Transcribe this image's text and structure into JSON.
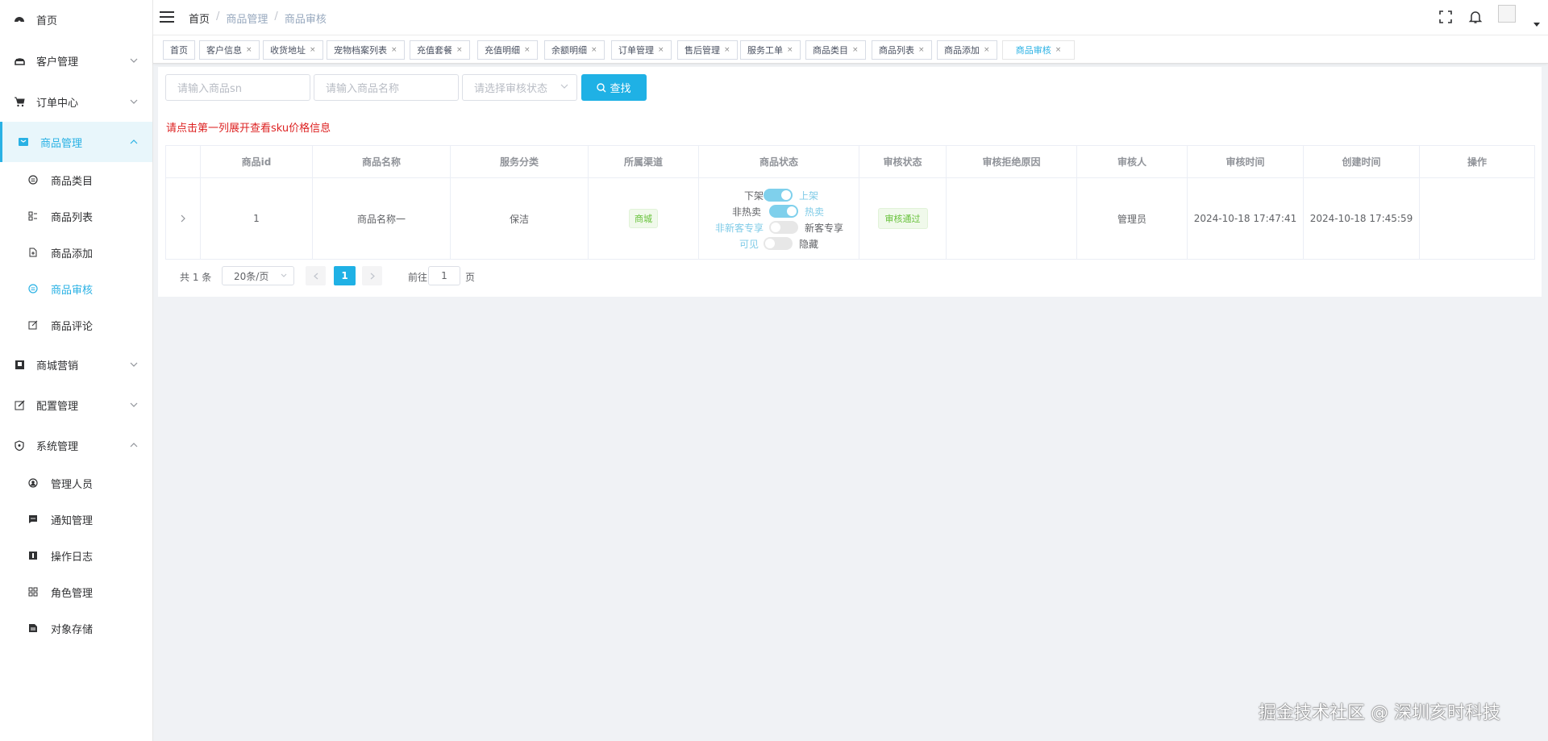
{
  "sidebar": {
    "items": [
      {
        "label": "首页",
        "icon": "dashboard-icon"
      },
      {
        "label": "客户管理",
        "icon": "customer-icon"
      },
      {
        "label": "订单中心",
        "icon": "cart-icon"
      },
      {
        "label": "商品管理",
        "icon": "goods-icon"
      },
      {
        "label": "商城营销",
        "icon": "marketing-icon"
      },
      {
        "label": "配置管理",
        "icon": "edit-icon"
      },
      {
        "label": "系统管理",
        "icon": "shield-icon"
      }
    ],
    "goods_sub": [
      {
        "label": "商品类目",
        "icon": "category-icon"
      },
      {
        "label": "商品列表",
        "icon": "list-icon"
      },
      {
        "label": "商品添加",
        "icon": "add-icon"
      },
      {
        "label": "商品审核",
        "icon": "audit-icon"
      },
      {
        "label": "商品评论",
        "icon": "comment-icon"
      }
    ],
    "system_sub": [
      {
        "label": "管理人员",
        "icon": "user-icon"
      },
      {
        "label": "通知管理",
        "icon": "message-icon"
      },
      {
        "label": "操作日志",
        "icon": "log-icon"
      },
      {
        "label": "角色管理",
        "icon": "role-icon"
      },
      {
        "label": "对象存储",
        "icon": "storage-icon"
      }
    ]
  },
  "header": {
    "breadcrumb": [
      "首页",
      "商品管理",
      "商品审核"
    ]
  },
  "tags": [
    "首页",
    "客户信息",
    "收货地址",
    "宠物档案列表",
    "充值套餐",
    "充值明细",
    "余额明细",
    "订单管理",
    "售后管理",
    "服务工单",
    "商品类目",
    "商品列表",
    "商品添加",
    "商品审核"
  ],
  "filters": {
    "sn_placeholder": "请输入商品sn",
    "name_placeholder": "请输入商品名称",
    "status_placeholder": "请选择审核状态",
    "search_label": "查找"
  },
  "hint": "请点击第一列展开查看sku价格信息",
  "table": {
    "columns": [
      "商品id",
      "商品名称",
      "服务分类",
      "所属渠道",
      "商品状态",
      "审核状态",
      "审核拒绝原因",
      "审核人",
      "审核时间",
      "创建时间",
      "操作"
    ],
    "rows": [
      {
        "id": "1",
        "name": "商品名称一",
        "category": "保洁",
        "channel": "商城",
        "switches": [
          {
            "off": "下架",
            "on": "上架",
            "value": true
          },
          {
            "off": "非热卖",
            "on": "热卖",
            "value": true
          },
          {
            "off": "非新客专享",
            "on": "新客专享",
            "value": false
          },
          {
            "off": "可见",
            "on": "隐藏",
            "value": false
          }
        ],
        "audit_status": "审核通过",
        "reject_reason": "",
        "auditor": "管理员",
        "audit_time": "2024-10-18 17:47:41",
        "create_time": "2024-10-18 17:45:59"
      }
    ]
  },
  "pagination": {
    "total": "共 1 条",
    "page_size": "20条/页",
    "current": "1",
    "goto_prefix": "前往",
    "goto_value": "1",
    "goto_suffix": "页"
  },
  "watermark": "掘金技术社区 @ 深圳亥时科技",
  "colors": {
    "accent": "#1fb1e5",
    "hint": "#dd2222",
    "success": "#67c23a"
  }
}
